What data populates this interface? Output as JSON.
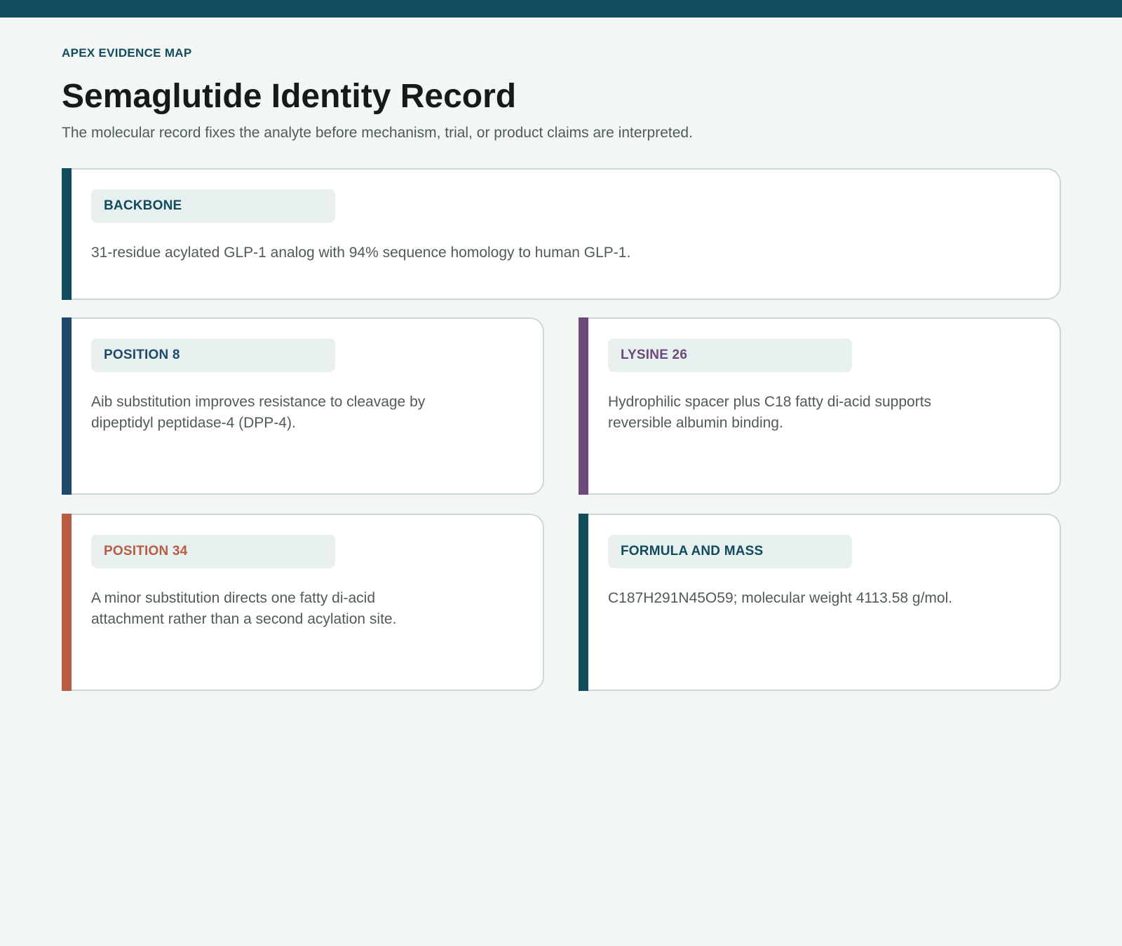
{
  "header": {
    "eyebrow": "APEX EVIDENCE MAP",
    "title": "Semaglutide Identity Record",
    "subtitle": "The molecular record fixes the analyte before mechanism, trial, or product claims are interpreted."
  },
  "cards": [
    {
      "tag": "BACKBONE",
      "body": "31-residue acylated GLP-1 analog with 94% sequence homology to human GLP-1.",
      "accent_color": "#114b5c"
    },
    {
      "tag": "POSITION 8",
      "body": "Aib substitution improves resistance to cleavage by dipeptidyl peptidase-4 (DPP-4).",
      "accent_color": "#1f4a6b"
    },
    {
      "tag": "LYSINE 26",
      "body": "Hydrophilic spacer plus C18 fatty di-acid supports reversible albumin binding.",
      "accent_color": "#6d4a7b"
    },
    {
      "tag": "POSITION 34",
      "body": "A minor substitution directs one fatty di-acid attachment rather than a second acylation site.",
      "accent_color": "#b85c43"
    },
    {
      "tag": "FORMULA AND MASS",
      "body": "C187H291N45O59; molecular weight 4113.58 g/mol.",
      "accent_color": "#114b5c"
    }
  ]
}
